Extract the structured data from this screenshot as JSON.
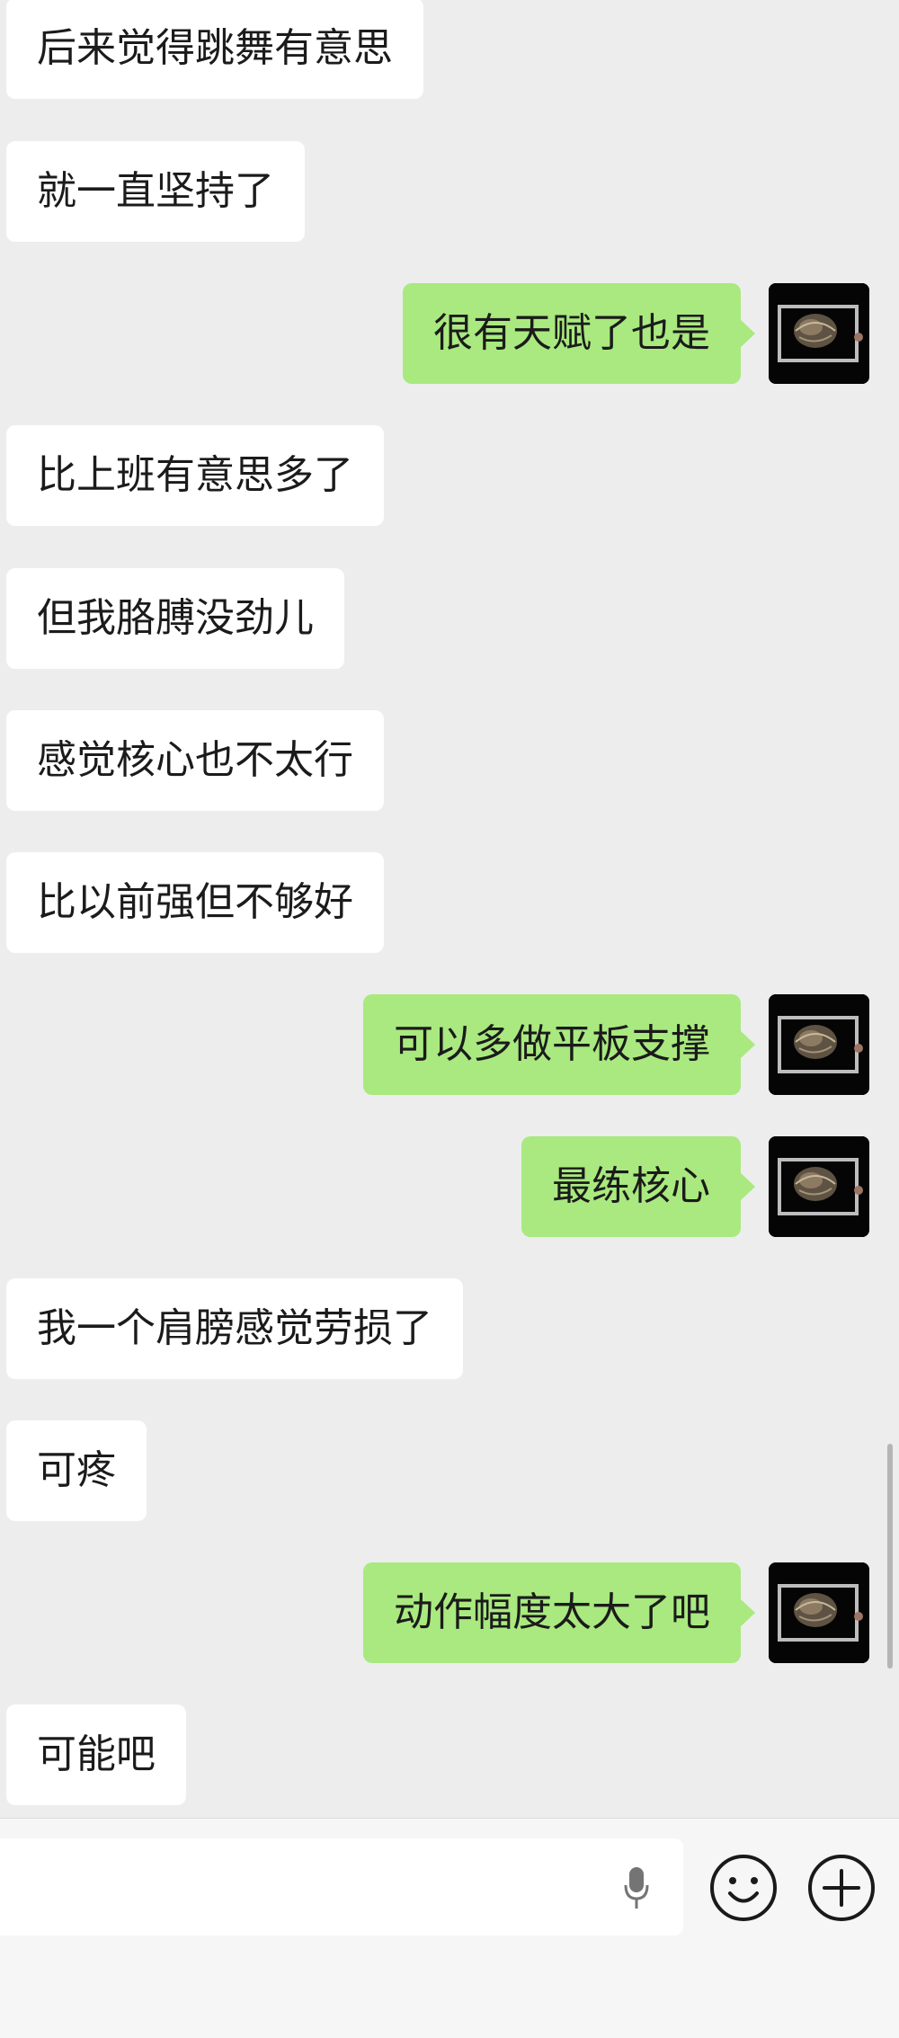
{
  "messages": [
    {
      "side": "left",
      "text": "后来觉得跳舞有意思"
    },
    {
      "side": "left",
      "text": "就一直坚持了"
    },
    {
      "side": "right",
      "text": "很有天赋了也是"
    },
    {
      "side": "left",
      "text": "比上班有意思多了"
    },
    {
      "side": "left",
      "text": "但我胳膊没劲儿"
    },
    {
      "side": "left",
      "text": "感觉核心也不太行"
    },
    {
      "side": "left",
      "text": "比以前强但不够好"
    },
    {
      "side": "right",
      "text": "可以多做平板支撑"
    },
    {
      "side": "right",
      "text": "最练核心"
    },
    {
      "side": "left",
      "text": "我一个肩膀感觉劳损了"
    },
    {
      "side": "left",
      "text": "可疼"
    },
    {
      "side": "right",
      "text": "动作幅度太大了吧"
    },
    {
      "side": "left",
      "text": "可能吧"
    }
  ],
  "colors": {
    "background": "#ededed",
    "incoming_bubble": "#ffffff",
    "outgoing_bubble": "#a9e97f",
    "input_bar": "#f6f6f6"
  },
  "icons": {
    "voice": "microphone-icon",
    "emoji": "smiley-face-icon",
    "more": "plus-circle-icon"
  }
}
